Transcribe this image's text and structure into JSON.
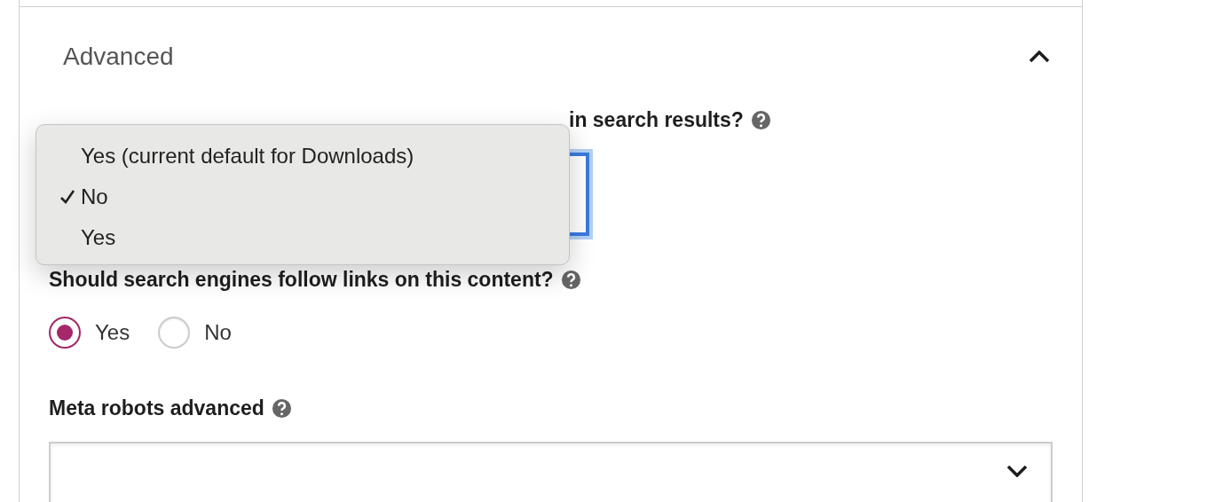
{
  "section": {
    "title": "Advanced",
    "expanded": true
  },
  "index_question": {
    "label": "in search results?",
    "menu": [
      {
        "label": "Yes (current default for Downloads)",
        "selected": false
      },
      {
        "label": "No",
        "selected": true
      },
      {
        "label": "Yes",
        "selected": false
      }
    ]
  },
  "follow_question": {
    "label": "Should search engines follow links on this content?",
    "options": [
      {
        "label": "Yes",
        "selected": true
      },
      {
        "label": "No",
        "selected": false
      }
    ]
  },
  "meta_robots": {
    "label": "Meta robots advanced"
  }
}
